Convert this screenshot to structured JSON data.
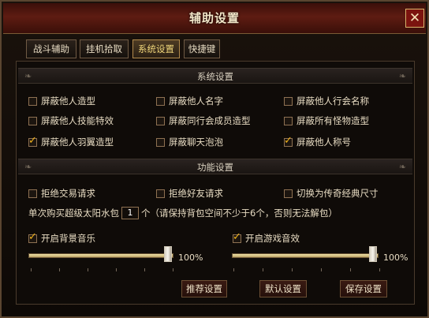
{
  "window": {
    "title": "辅助设置",
    "close_icon": "close-icon"
  },
  "tabs": [
    {
      "label": "战斗辅助",
      "active": false
    },
    {
      "label": "挂机拾取",
      "active": false
    },
    {
      "label": "系统设置",
      "active": true
    },
    {
      "label": "快捷键",
      "active": false
    }
  ],
  "system_settings": {
    "title": "系统设置",
    "options": [
      {
        "label": "屏蔽他人造型",
        "checked": false
      },
      {
        "label": "屏蔽他人名字",
        "checked": false
      },
      {
        "label": "屏蔽他人行会名称",
        "checked": false
      },
      {
        "label": "屏蔽他人技能特效",
        "checked": false
      },
      {
        "label": "屏蔽同行会成员造型",
        "checked": false
      },
      {
        "label": "屏蔽所有怪物造型",
        "checked": false
      },
      {
        "label": "屏蔽他人羽翼造型",
        "checked": true
      },
      {
        "label": "屏蔽聊天泡泡",
        "checked": false
      },
      {
        "label": "屏蔽他人称号",
        "checked": true
      }
    ]
  },
  "function_settings": {
    "title": "功能设置",
    "options": [
      {
        "label": "拒绝交易请求",
        "checked": false
      },
      {
        "label": "拒绝好友请求",
        "checked": false
      },
      {
        "label": "切换为传奇经典尺寸",
        "checked": false
      }
    ],
    "purchase": {
      "prefix": "单次购买超级太阳水包",
      "value": "1",
      "suffix": "个（请保持背包空间不少于6个，否则无法解包）"
    },
    "music": {
      "label": "开启背景音乐",
      "checked": true,
      "level_percent": 100,
      "value_label": "100%"
    },
    "sfx": {
      "label": "开启游戏音效",
      "checked": true,
      "level_percent": 100,
      "value_label": "100%"
    }
  },
  "buttons": {
    "recommend": "推荐设置",
    "default": "默认设置",
    "save": "保存设置"
  }
}
